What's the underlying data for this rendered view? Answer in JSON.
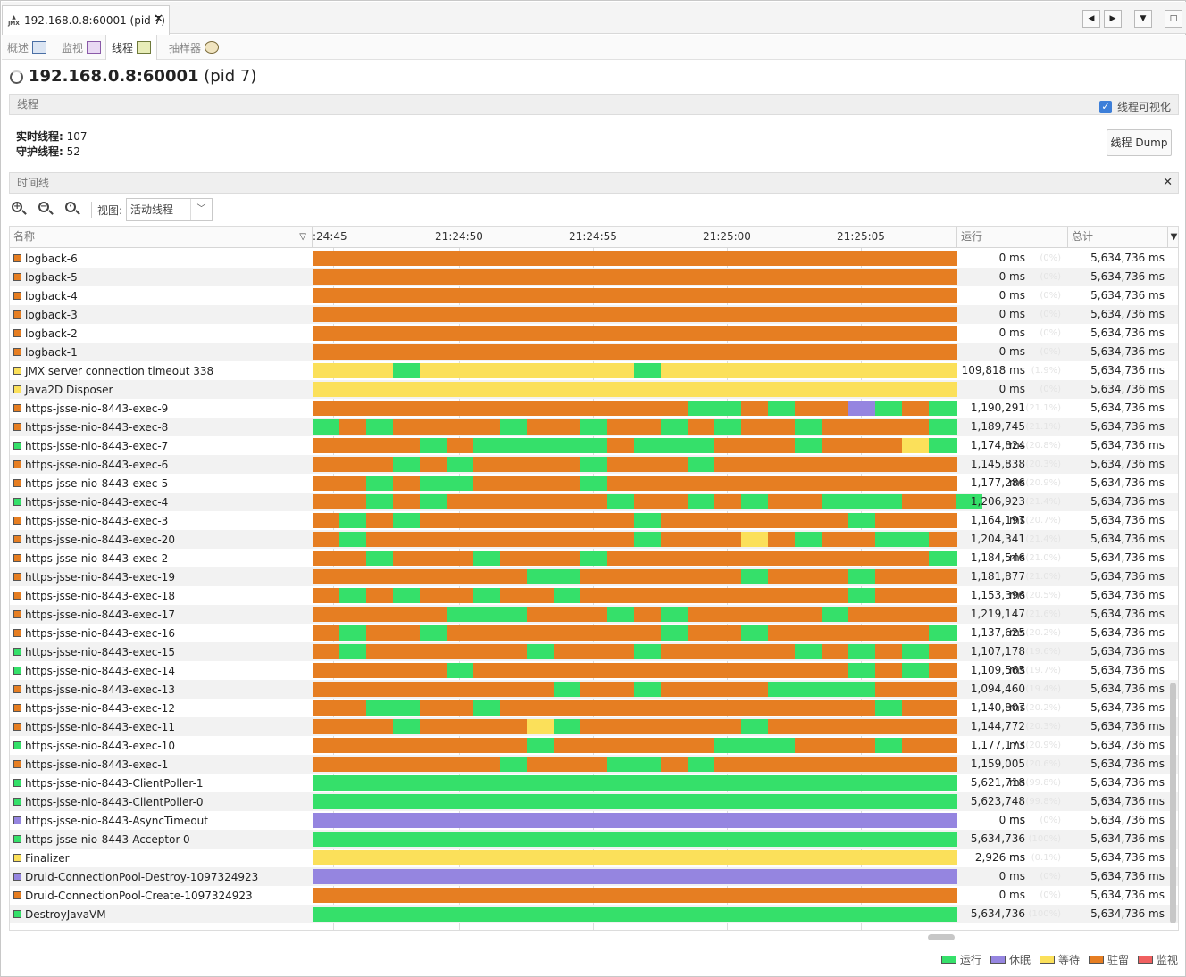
{
  "window": {
    "tab_title": "192.168.0.8:60001 (pid 7)",
    "close": "✕",
    "nav": [
      "◀",
      "▶",
      "▼",
      "□"
    ]
  },
  "subtabs": [
    "概述",
    "监视",
    "线程",
    "抽样器"
  ],
  "header": {
    "host": "192.168.0.8:60001",
    "pid": "(pid 7)"
  },
  "threads_section": {
    "title": "线程",
    "visualize_label": "线程可视化",
    "visualize_checked": true,
    "live_label": "实时线程:",
    "live_value": "107",
    "daemon_label": "守护线程:",
    "daemon_value": "52",
    "dump_button": "线程 Dump"
  },
  "timeline_section": {
    "title": "时间线",
    "close": "✕",
    "view_label": "视图:",
    "view_value": "活动线程"
  },
  "columns": {
    "name": "名称",
    "run": "运行",
    "total": "总计"
  },
  "ticks": [
    ":24:45",
    "21:24:50",
    "21:24:55",
    "21:25:00",
    "21:25:05"
  ],
  "states": {
    "R": {
      "label": "运行",
      "color": "#35e06a"
    },
    "S": {
      "label": "休眠",
      "color": "#9585e0"
    },
    "W": {
      "label": "等待",
      "color": "#fbe05a"
    },
    "P": {
      "label": "驻留",
      "color": "#e67e22"
    },
    "M": {
      "label": "监视",
      "color": "#f06060"
    }
  },
  "threads": [
    {
      "name": "logback-6",
      "state": "P",
      "run": "0 ms",
      "pct": "(0%)",
      "total": "5,634,736 ms",
      "segs": [
        [
          "P",
          72
        ]
      ]
    },
    {
      "name": "logback-5",
      "state": "P",
      "run": "0 ms",
      "pct": "(0%)",
      "total": "5,634,736 ms",
      "segs": [
        [
          "P",
          72
        ]
      ]
    },
    {
      "name": "logback-4",
      "state": "P",
      "run": "0 ms",
      "pct": "(0%)",
      "total": "5,634,736 ms",
      "segs": [
        [
          "P",
          72
        ]
      ]
    },
    {
      "name": "logback-3",
      "state": "P",
      "run": "0 ms",
      "pct": "(0%)",
      "total": "5,634,736 ms",
      "segs": [
        [
          "P",
          72
        ]
      ]
    },
    {
      "name": "logback-2",
      "state": "P",
      "run": "0 ms",
      "pct": "(0%)",
      "total": "5,634,736 ms",
      "segs": [
        [
          "P",
          72
        ]
      ]
    },
    {
      "name": "logback-1",
      "state": "P",
      "run": "0 ms",
      "pct": "(0%)",
      "total": "5,634,736 ms",
      "segs": [
        [
          "P",
          72
        ]
      ]
    },
    {
      "name": "JMX server connection timeout 338",
      "state": "W",
      "run": "109,818 ms",
      "pct": "(1.9%)",
      "total": "5,634,736 ms",
      "segs": [
        [
          "W",
          9
        ],
        [
          "R",
          3
        ],
        [
          "W",
          24
        ],
        [
          "R",
          3
        ],
        [
          "W",
          33
        ]
      ]
    },
    {
      "name": "Java2D Disposer",
      "state": "W",
      "run": "0 ms",
      "pct": "(0%)",
      "total": "5,634,736 ms",
      "segs": [
        [
          "W",
          72
        ]
      ]
    },
    {
      "name": "https-jsse-nio-8443-exec-9",
      "state": "P",
      "run": "1,190,291 ms",
      "pct": "(21.1%)",
      "total": "5,634,736 ms",
      "segs": [
        [
          "P",
          42
        ],
        [
          "R",
          6
        ],
        [
          "P",
          3
        ],
        [
          "R",
          3
        ],
        [
          "P",
          6
        ],
        [
          "S",
          3
        ],
        [
          "R",
          3
        ],
        [
          "P",
          3
        ],
        [
          "R",
          3
        ]
      ]
    },
    {
      "name": "https-jsse-nio-8443-exec-8",
      "state": "P",
      "run": "1,189,745 ms",
      "pct": "(21.1%)",
      "total": "5,634,736 ms",
      "segs": [
        [
          "R",
          3
        ],
        [
          "P",
          3
        ],
        [
          "R",
          3
        ],
        [
          "P",
          12
        ],
        [
          "R",
          3
        ],
        [
          "P",
          6
        ],
        [
          "R",
          3
        ],
        [
          "P",
          6
        ],
        [
          "R",
          3
        ],
        [
          "P",
          3
        ],
        [
          "R",
          3
        ],
        [
          "P",
          6
        ],
        [
          "R",
          3
        ],
        [
          "P",
          12
        ],
        [
          "R",
          3
        ]
      ]
    },
    {
      "name": "https-jsse-nio-8443-exec-7",
      "state": "R",
      "run": "1,174,824 ms",
      "pct": "(20.8%)",
      "total": "5,634,736 ms",
      "segs": [
        [
          "P",
          12
        ],
        [
          "R",
          3
        ],
        [
          "P",
          3
        ],
        [
          "R",
          15
        ],
        [
          "P",
          3
        ],
        [
          "R",
          9
        ],
        [
          "P",
          9
        ],
        [
          "R",
          3
        ],
        [
          "P",
          9
        ],
        [
          "W",
          3
        ],
        [
          "R",
          3
        ]
      ]
    },
    {
      "name": "https-jsse-nio-8443-exec-6",
      "state": "P",
      "run": "1,145,838 ms",
      "pct": "(20.3%)",
      "total": "5,634,736 ms",
      "segs": [
        [
          "P",
          9
        ],
        [
          "R",
          3
        ],
        [
          "P",
          3
        ],
        [
          "R",
          3
        ],
        [
          "P",
          12
        ],
        [
          "R",
          3
        ],
        [
          "P",
          9
        ],
        [
          "R",
          3
        ],
        [
          "P",
          27
        ]
      ]
    },
    {
      "name": "https-jsse-nio-8443-exec-5",
      "state": "P",
      "run": "1,177,286 ms",
      "pct": "(20.9%)",
      "total": "5,634,736 ms",
      "segs": [
        [
          "P",
          6
        ],
        [
          "R",
          3
        ],
        [
          "P",
          3
        ],
        [
          "R",
          6
        ],
        [
          "P",
          12
        ],
        [
          "R",
          3
        ],
        [
          "P",
          39
        ]
      ]
    },
    {
      "name": "https-jsse-nio-8443-exec-4",
      "state": "R",
      "run": "1,206,923 ms",
      "pct": "(21.4%)",
      "total": "5,634,736 ms",
      "segs": [
        [
          "P",
          6
        ],
        [
          "R",
          3
        ],
        [
          "P",
          3
        ],
        [
          "R",
          3
        ],
        [
          "P",
          18
        ],
        [
          "R",
          3
        ],
        [
          "P",
          6
        ],
        [
          "R",
          3
        ],
        [
          "P",
          3
        ],
        [
          "R",
          3
        ],
        [
          "P",
          6
        ],
        [
          "R",
          9
        ],
        [
          "P",
          6
        ],
        [
          "R",
          3
        ],
        [
          "P",
          3
        ]
      ]
    },
    {
      "name": "https-jsse-nio-8443-exec-3",
      "state": "P",
      "run": "1,164,197 ms",
      "pct": "(20.7%)",
      "total": "5,634,736 ms",
      "segs": [
        [
          "P",
          3
        ],
        [
          "R",
          3
        ],
        [
          "P",
          3
        ],
        [
          "R",
          3
        ],
        [
          "P",
          24
        ],
        [
          "R",
          3
        ],
        [
          "P",
          21
        ],
        [
          "R",
          3
        ],
        [
          "P",
          9
        ]
      ]
    },
    {
      "name": "https-jsse-nio-8443-exec-20",
      "state": "P",
      "run": "1,204,341 ms",
      "pct": "(21.4%)",
      "total": "5,634,736 ms",
      "segs": [
        [
          "P",
          3
        ],
        [
          "R",
          3
        ],
        [
          "P",
          30
        ],
        [
          "R",
          3
        ],
        [
          "P",
          9
        ],
        [
          "W",
          3
        ],
        [
          "P",
          3
        ],
        [
          "R",
          3
        ],
        [
          "P",
          6
        ],
        [
          "R",
          6
        ],
        [
          "P",
          3
        ]
      ]
    },
    {
      "name": "https-jsse-nio-8443-exec-2",
      "state": "P",
      "run": "1,184,546 ms",
      "pct": "(21.0%)",
      "total": "5,634,736 ms",
      "segs": [
        [
          "P",
          6
        ],
        [
          "R",
          3
        ],
        [
          "P",
          9
        ],
        [
          "R",
          3
        ],
        [
          "P",
          9
        ],
        [
          "R",
          3
        ],
        [
          "P",
          36
        ],
        [
          "R",
          3
        ]
      ]
    },
    {
      "name": "https-jsse-nio-8443-exec-19",
      "state": "P",
      "run": "1,181,877 ms",
      "pct": "(21.0%)",
      "total": "5,634,736 ms",
      "segs": [
        [
          "P",
          24
        ],
        [
          "R",
          6
        ],
        [
          "P",
          18
        ],
        [
          "R",
          3
        ],
        [
          "P",
          9
        ],
        [
          "R",
          3
        ],
        [
          "P",
          9
        ]
      ]
    },
    {
      "name": "https-jsse-nio-8443-exec-18",
      "state": "P",
      "run": "1,153,396 ms",
      "pct": "(20.5%)",
      "total": "5,634,736 ms",
      "segs": [
        [
          "P",
          3
        ],
        [
          "R",
          3
        ],
        [
          "P",
          3
        ],
        [
          "R",
          3
        ],
        [
          "P",
          6
        ],
        [
          "R",
          3
        ],
        [
          "P",
          6
        ],
        [
          "R",
          3
        ],
        [
          "P",
          30
        ],
        [
          "R",
          3
        ],
        [
          "P",
          9
        ]
      ]
    },
    {
      "name": "https-jsse-nio-8443-exec-17",
      "state": "P",
      "run": "1,219,147 ms",
      "pct": "(21.6%)",
      "total": "5,634,736 ms",
      "segs": [
        [
          "P",
          15
        ],
        [
          "R",
          9
        ],
        [
          "P",
          9
        ],
        [
          "R",
          3
        ],
        [
          "P",
          3
        ],
        [
          "R",
          3
        ],
        [
          "P",
          15
        ],
        [
          "R",
          3
        ],
        [
          "P",
          12
        ]
      ]
    },
    {
      "name": "https-jsse-nio-8443-exec-16",
      "state": "P",
      "run": "1,137,625 ms",
      "pct": "(20.2%)",
      "total": "5,634,736 ms",
      "segs": [
        [
          "P",
          3
        ],
        [
          "R",
          3
        ],
        [
          "P",
          6
        ],
        [
          "R",
          3
        ],
        [
          "P",
          24
        ],
        [
          "R",
          3
        ],
        [
          "P",
          6
        ],
        [
          "R",
          3
        ],
        [
          "P",
          18
        ],
        [
          "R",
          3
        ]
      ]
    },
    {
      "name": "https-jsse-nio-8443-exec-15",
      "state": "R",
      "run": "1,107,178 ms",
      "pct": "(19.6%)",
      "total": "5,634,736 ms",
      "segs": [
        [
          "P",
          3
        ],
        [
          "R",
          3
        ],
        [
          "P",
          18
        ],
        [
          "R",
          3
        ],
        [
          "P",
          9
        ],
        [
          "R",
          3
        ],
        [
          "P",
          15
        ],
        [
          "R",
          3
        ],
        [
          "P",
          3
        ],
        [
          "R",
          3
        ],
        [
          "P",
          3
        ],
        [
          "R",
          3
        ],
        [
          "P",
          3
        ]
      ]
    },
    {
      "name": "https-jsse-nio-8443-exec-14",
      "state": "R",
      "run": "1,109,565 ms",
      "pct": "(19.7%)",
      "total": "5,634,736 ms",
      "segs": [
        [
          "P",
          15
        ],
        [
          "R",
          3
        ],
        [
          "P",
          42
        ],
        [
          "R",
          3
        ],
        [
          "P",
          3
        ],
        [
          "R",
          3
        ],
        [
          "P",
          3
        ]
      ]
    },
    {
      "name": "https-jsse-nio-8443-exec-13",
      "state": "P",
      "run": "1,094,460 ms",
      "pct": "(19.4%)",
      "total": "5,634,736 ms",
      "segs": [
        [
          "P",
          27
        ],
        [
          "R",
          3
        ],
        [
          "P",
          6
        ],
        [
          "R",
          3
        ],
        [
          "P",
          12
        ],
        [
          "R",
          12
        ],
        [
          "P",
          9
        ]
      ]
    },
    {
      "name": "https-jsse-nio-8443-exec-12",
      "state": "P",
      "run": "1,140,807 ms",
      "pct": "(20.2%)",
      "total": "5,634,736 ms",
      "segs": [
        [
          "P",
          6
        ],
        [
          "R",
          6
        ],
        [
          "P",
          6
        ],
        [
          "R",
          3
        ],
        [
          "P",
          42
        ],
        [
          "R",
          3
        ],
        [
          "P",
          6
        ]
      ]
    },
    {
      "name": "https-jsse-nio-8443-exec-11",
      "state": "P",
      "run": "1,144,772 ms",
      "pct": "(20.3%)",
      "total": "5,634,736 ms",
      "segs": [
        [
          "P",
          9
        ],
        [
          "R",
          3
        ],
        [
          "P",
          12
        ],
        [
          "W",
          3
        ],
        [
          "R",
          3
        ],
        [
          "P",
          18
        ],
        [
          "R",
          3
        ],
        [
          "P",
          24
        ]
      ]
    },
    {
      "name": "https-jsse-nio-8443-exec-10",
      "state": "R",
      "run": "1,177,173 ms",
      "pct": "(20.9%)",
      "total": "5,634,736 ms",
      "segs": [
        [
          "P",
          24
        ],
        [
          "R",
          3
        ],
        [
          "P",
          18
        ],
        [
          "R",
          9
        ],
        [
          "P",
          9
        ],
        [
          "R",
          3
        ],
        [
          "P",
          6
        ]
      ]
    },
    {
      "name": "https-jsse-nio-8443-exec-1",
      "state": "P",
      "run": "1,159,005 ms",
      "pct": "(20.6%)",
      "total": "5,634,736 ms",
      "segs": [
        [
          "P",
          21
        ],
        [
          "R",
          3
        ],
        [
          "P",
          9
        ],
        [
          "R",
          6
        ],
        [
          "P",
          3
        ],
        [
          "R",
          3
        ],
        [
          "P",
          27
        ]
      ]
    },
    {
      "name": "https-jsse-nio-8443-ClientPoller-1",
      "state": "R",
      "run": "5,621,718 ms",
      "pct": "(99.8%)",
      "total": "5,634,736 ms",
      "segs": [
        [
          "R",
          72
        ]
      ]
    },
    {
      "name": "https-jsse-nio-8443-ClientPoller-0",
      "state": "R",
      "run": "5,623,748 ms",
      "pct": "(99.8%)",
      "total": "5,634,736 ms",
      "segs": [
        [
          "R",
          72
        ]
      ]
    },
    {
      "name": "https-jsse-nio-8443-AsyncTimeout",
      "state": "S",
      "run": "0 ms",
      "pct": "(0%)",
      "total": "5,634,736 ms",
      "segs": [
        [
          "S",
          72
        ]
      ]
    },
    {
      "name": "https-jsse-nio-8443-Acceptor-0",
      "state": "R",
      "run": "5,634,736 ms",
      "pct": "(100%)",
      "total": "5,634,736 ms",
      "segs": [
        [
          "R",
          72
        ]
      ]
    },
    {
      "name": "Finalizer",
      "state": "W",
      "run": "2,926 ms",
      "pct": "(0.1%)",
      "total": "5,634,736 ms",
      "segs": [
        [
          "W",
          72
        ]
      ]
    },
    {
      "name": "Druid-ConnectionPool-Destroy-1097324923",
      "state": "S",
      "run": "0 ms",
      "pct": "(0%)",
      "total": "5,634,736 ms",
      "segs": [
        [
          "S",
          72
        ]
      ]
    },
    {
      "name": "Druid-ConnectionPool-Create-1097324923",
      "state": "P",
      "run": "0 ms",
      "pct": "(0%)",
      "total": "5,634,736 ms",
      "segs": [
        [
          "P",
          72
        ]
      ]
    },
    {
      "name": "DestroyJavaVM",
      "state": "R",
      "run": "5,634,736 ms",
      "pct": "(100%)",
      "total": "5,634,736 ms",
      "segs": [
        [
          "R",
          72
        ]
      ]
    }
  ]
}
